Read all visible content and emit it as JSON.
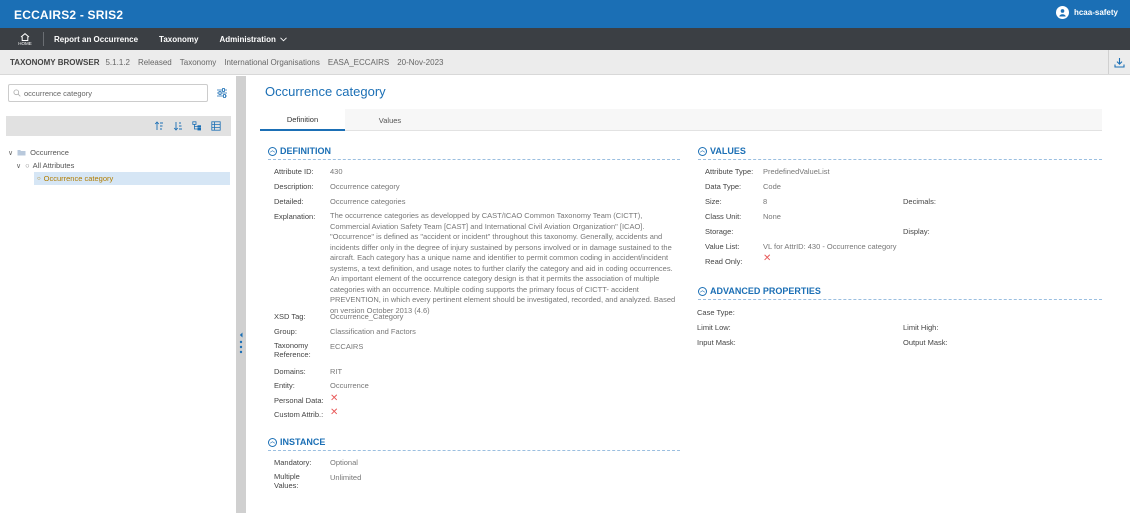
{
  "app": {
    "title": "ECCAIRS2 - SRIS2",
    "user": "hcaa-safety"
  },
  "nav": {
    "home_label": "HOME",
    "items": [
      "Report an Occurrence",
      "Taxonomy",
      "Administration"
    ]
  },
  "crumbs": {
    "browser": "TAXONOMY BROWSER",
    "version": "5.1.1.2",
    "status": "Released",
    "taxonomy": "Taxonomy",
    "org": "International Organisations",
    "name": "EASA_ECCAIRS",
    "date": "20-Nov-2023"
  },
  "search": {
    "value": "occurrence category",
    "placeholder": "occurrence category"
  },
  "tree": {
    "root": "Occurrence",
    "child": "All Attributes",
    "leaf": "Occurrence category"
  },
  "main": {
    "title": "Occurrence category",
    "tabs": [
      "Definition",
      "Values"
    ]
  },
  "definition": {
    "heading": "DEFINITION",
    "labels": {
      "attr_id": "Attribute ID:",
      "description": "Description:",
      "detailed": "Detailed:",
      "explanation": "Explanation:",
      "xsd": "XSD Tag:",
      "group": "Group:",
      "taxref": "Taxonomy Reference:",
      "domains": "Domains:",
      "entity": "Entity:",
      "personal": "Personal Data:",
      "custom": "Custom Attrib.:"
    },
    "values": {
      "attr_id": "430",
      "description": "Occurrence category",
      "detailed": "Occurrence categories",
      "explanation": "The occurrence categories as developped by CAST/ICAO Common Taxonomy Team (CICTT), Commercial Aviation Safety Team [CAST] and International Civil Aviation Organization\" [ICAO]. \"Occurrence\" is defined as \"accident or incident\" throughout this taxonomy. Generally, accidents and incidents differ only in the degree of injury sustained by persons involved or in damage sustained to the aircraft. Each category has a unique name and identifier to permit common coding in accident/incident systems, a text definition, and usage notes to further clarify the category and aid in coding occurrences. An important element of the occurrence category design is that it permits the association of multiple categories with an occurrence. Multiple coding supports the primary focus of CICTT- accident PREVENTION, in which every pertinent element should be investigated, recorded, and analyzed. Based on version October 2013 (4.6)",
      "xsd": "Occurrence_Category",
      "group": "Classification and Factors",
      "taxref": "ECCAIRS",
      "domains": "RIT",
      "entity": "Occurrence"
    }
  },
  "instance": {
    "heading": "INSTANCE",
    "mandatory_label": "Mandatory:",
    "mandatory": "Optional",
    "multiple_label": "Multiple Values:",
    "multiple": "Unlimited"
  },
  "values_section": {
    "heading": "VALUES",
    "attr_type_label": "Attribute Type:",
    "attr_type": "PredefinedValueList",
    "data_type_label": "Data Type:",
    "data_type": "Code",
    "size_label": "Size:",
    "size": "8",
    "decimals_label": "Decimals:",
    "class_unit_label": "Class Unit:",
    "class_unit": "None",
    "storage_label": "Storage:",
    "display_label": "Display:",
    "value_list_label": "Value List:",
    "value_list": "VL for AttrID: 430 - Occurrence category",
    "read_only_label": "Read Only:"
  },
  "advanced": {
    "heading": "ADVANCED PROPERTIES",
    "case_type_label": "Case Type:",
    "limit_low_label": "Limit Low:",
    "limit_high_label": "Limit High:",
    "input_mask_label": "Input Mask:",
    "output_mask_label": "Output Mask:"
  },
  "colors": {
    "topbar": "#1b6fb5",
    "navbar": "#3b3f44",
    "accent": "#1b6fb5",
    "false_mark": "#e85a5a"
  }
}
